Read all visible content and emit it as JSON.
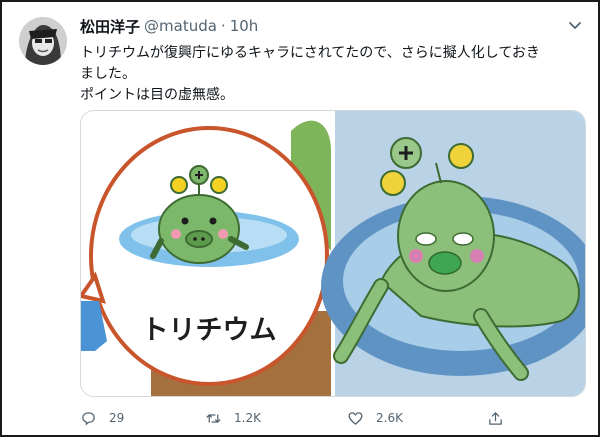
{
  "author": {
    "display_name": "松田洋子",
    "handle": "@matuda",
    "separator": "·",
    "time": "10h"
  },
  "tweet": {
    "lines": [
      "トリチウムが復興庁にゆるキャラにされてたので、さらに擬人化しておき",
      "ました。",
      "ポイントは目の虚無感。"
    ]
  },
  "media": {
    "left_image_caption": "トリチウム"
  },
  "actions": {
    "reply_count": "29",
    "retweet_count": "1.2K",
    "like_count": "2.6K"
  },
  "colors": {
    "text": "#0f1419",
    "muted": "#536471",
    "mascot_green": "#7cb86a",
    "bubble_border": "#c8552b"
  }
}
